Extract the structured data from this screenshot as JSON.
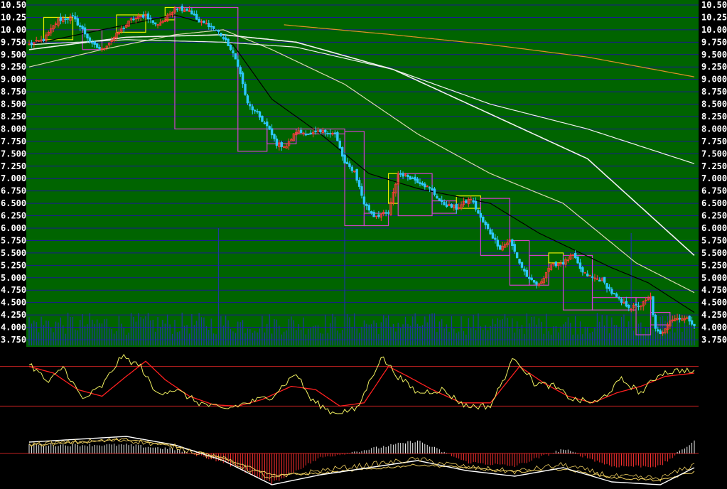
{
  "chart_data": {
    "type": "line",
    "subtype": "candlestick-with-indicators",
    "colors": {
      "price_background": "#006400",
      "indicator_background": "#000000",
      "gridline": "#1a1a90",
      "up_candle": "#ff3b3b",
      "down_candle": "#2ec8ff",
      "volume_bar": "#1d3a9e",
      "ma_short": "#000000",
      "ma_medium": "#d8d8b0",
      "ma_long": "#f0f0f0",
      "ma_longest": "#e0902a",
      "box_up": "#e8f000",
      "box_down": "#d040d0",
      "oscillator_k": "#f0f060",
      "oscillator_d": "#ff2020",
      "macd_dif": "#ffffff",
      "macd_dea": "#f0d060",
      "macd_hist_pos": "#f0f0f0",
      "macd_hist_neg": "#ff3030",
      "reference_line": "#c02020",
      "tick_label": "#ffffff"
    },
    "y_axis": {
      "ylim": [
        3.75,
        10.5
      ],
      "ticks": [
        "10.50",
        "10.25",
        "10.00",
        "9.750",
        "9.500",
        "9.250",
        "9.000",
        "8.750",
        "8.500",
        "8.250",
        "8.000",
        "7.750",
        "7.500",
        "7.250",
        "7.000",
        "6.750",
        "6.500",
        "6.250",
        "6.000",
        "5.750",
        "5.500",
        "5.250",
        "5.000",
        "4.750",
        "4.500",
        "4.250",
        "4.000",
        "3.750"
      ],
      "label_sides": [
        "left",
        "right"
      ],
      "grid": true
    },
    "price_series": {
      "bars": 220,
      "anchors": [
        [
          0,
          9.7
        ],
        [
          6,
          9.8
        ],
        [
          12,
          10.2
        ],
        [
          18,
          10.25
        ],
        [
          22,
          10.0
        ],
        [
          26,
          9.7
        ],
        [
          30,
          9.6
        ],
        [
          36,
          9.9
        ],
        [
          42,
          10.2
        ],
        [
          48,
          10.3
        ],
        [
          52,
          10.1
        ],
        [
          56,
          10.2
        ],
        [
          60,
          10.45
        ],
        [
          66,
          10.4
        ],
        [
          70,
          10.15
        ],
        [
          74,
          10.1
        ],
        [
          78,
          9.95
        ],
        [
          82,
          9.7
        ],
        [
          86,
          9.3
        ],
        [
          90,
          8.5
        ],
        [
          94,
          8.3
        ],
        [
          98,
          8.05
        ],
        [
          102,
          7.7
        ],
        [
          106,
          7.65
        ],
        [
          110,
          7.95
        ],
        [
          116,
          7.9
        ],
        [
          122,
          7.95
        ],
        [
          126,
          7.9
        ],
        [
          130,
          7.3
        ],
        [
          134,
          7.15
        ],
        [
          138,
          6.5
        ],
        [
          142,
          6.25
        ],
        [
          148,
          6.3
        ],
        [
          152,
          7.1
        ],
        [
          156,
          7.05
        ],
        [
          162,
          6.9
        ],
        [
          166,
          6.75
        ],
        [
          170,
          6.5
        ],
        [
          176,
          6.4
        ],
        [
          182,
          6.6
        ],
        [
          186,
          6.2
        ],
        [
          190,
          5.9
        ],
        [
          194,
          5.6
        ],
        [
          198,
          5.75
        ],
        [
          202,
          5.3
        ],
        [
          206,
          4.95
        ],
        [
          210,
          4.85
        ],
        [
          214,
          5.2
        ],
        [
          218,
          5.3
        ],
        [
          219,
          5.3
        ]
      ]
    },
    "price_series_tail": {
      "anchors": [
        [
          0,
          5.3
        ],
        [
          4,
          5.45
        ],
        [
          8,
          5.1
        ],
        [
          12,
          5.0
        ],
        [
          16,
          4.95
        ],
        [
          20,
          4.7
        ],
        [
          24,
          4.5
        ],
        [
          28,
          4.4
        ],
        [
          32,
          4.45
        ],
        [
          36,
          4.6
        ],
        [
          38,
          3.95
        ],
        [
          40,
          3.85
        ],
        [
          44,
          4.15
        ],
        [
          48,
          4.2
        ],
        [
          52,
          4.15
        ],
        [
          54,
          4.05
        ]
      ]
    },
    "moving_averages": [
      {
        "key": "ma_short",
        "anchors": [
          [
            0,
            9.7
          ],
          [
            40,
            10.1
          ],
          [
            60,
            10.3
          ],
          [
            74,
            10.1
          ],
          [
            84,
            9.7
          ],
          [
            100,
            8.6
          ],
          [
            120,
            7.9
          ],
          [
            140,
            7.1
          ],
          [
            160,
            6.8
          ],
          [
            190,
            6.5
          ],
          [
            210,
            5.9
          ],
          [
            240,
            5.2
          ],
          [
            255,
            4.9
          ],
          [
            274,
            4.3
          ]
        ]
      },
      {
        "key": "ma_medium",
        "anchors": [
          [
            0,
            9.25
          ],
          [
            30,
            9.6
          ],
          [
            60,
            9.9
          ],
          [
            80,
            10.0
          ],
          [
            100,
            9.6
          ],
          [
            130,
            8.9
          ],
          [
            160,
            7.9
          ],
          [
            190,
            7.1
          ],
          [
            220,
            6.5
          ],
          [
            250,
            5.3
          ],
          [
            274,
            4.7
          ]
        ]
      },
      {
        "key": "ma_long",
        "anchors": [
          [
            0,
            9.6
          ],
          [
            40,
            9.85
          ],
          [
            80,
            9.9
          ],
          [
            110,
            9.75
          ],
          [
            150,
            9.2
          ],
          [
            190,
            8.3
          ],
          [
            230,
            7.4
          ],
          [
            274,
            5.45
          ]
        ]
      },
      {
        "key": "ma_long_2",
        "anchors": [
          [
            0,
            9.7
          ],
          [
            40,
            9.8
          ],
          [
            80,
            9.75
          ],
          [
            110,
            9.65
          ],
          [
            150,
            9.2
          ],
          [
            190,
            8.5
          ],
          [
            230,
            8.0
          ],
          [
            274,
            7.3
          ]
        ]
      },
      {
        "key": "ma_longest",
        "anchors": [
          [
            105,
            10.1
          ],
          [
            150,
            9.9
          ],
          [
            190,
            9.7
          ],
          [
            230,
            9.45
          ],
          [
            274,
            9.05
          ]
        ]
      }
    ],
    "volume": {
      "description": "vertical bars along the bottom of the price panel",
      "spikes": [
        [
          78,
          6.0
        ],
        [
          130,
          6.0
        ],
        [
          248,
          5.9
        ]
      ]
    },
    "oscillator": {
      "reference_levels": [
        80,
        20
      ],
      "k_anchors": [
        [
          0,
          85
        ],
        [
          8,
          55
        ],
        [
          14,
          80
        ],
        [
          22,
          30
        ],
        [
          30,
          50
        ],
        [
          38,
          95
        ],
        [
          46,
          80
        ],
        [
          52,
          40
        ],
        [
          60,
          45
        ],
        [
          70,
          25
        ],
        [
          80,
          15
        ],
        [
          90,
          25
        ],
        [
          100,
          35
        ],
        [
          110,
          70
        ],
        [
          116,
          30
        ],
        [
          125,
          10
        ],
        [
          135,
          15
        ],
        [
          145,
          95
        ],
        [
          152,
          65
        ],
        [
          160,
          40
        ],
        [
          170,
          45
        ],
        [
          180,
          20
        ],
        [
          190,
          20
        ],
        [
          200,
          95
        ],
        [
          208,
          55
        ],
        [
          216,
          50
        ],
        [
          224,
          30
        ],
        [
          234,
          25
        ],
        [
          244,
          60
        ],
        [
          252,
          40
        ],
        [
          260,
          70
        ],
        [
          270,
          75
        ],
        [
          274,
          70
        ]
      ],
      "d_anchors": [
        [
          0,
          80
        ],
        [
          10,
          70
        ],
        [
          20,
          45
        ],
        [
          30,
          35
        ],
        [
          40,
          65
        ],
        [
          48,
          88
        ],
        [
          56,
          60
        ],
        [
          66,
          35
        ],
        [
          76,
          22
        ],
        [
          86,
          20
        ],
        [
          96,
          30
        ],
        [
          108,
          50
        ],
        [
          118,
          45
        ],
        [
          128,
          20
        ],
        [
          138,
          25
        ],
        [
          148,
          80
        ],
        [
          156,
          65
        ],
        [
          166,
          45
        ],
        [
          178,
          25
        ],
        [
          190,
          25
        ],
        [
          202,
          80
        ],
        [
          212,
          55
        ],
        [
          222,
          35
        ],
        [
          232,
          25
        ],
        [
          242,
          40
        ],
        [
          252,
          50
        ],
        [
          262,
          65
        ],
        [
          274,
          70
        ]
      ]
    },
    "macd": {
      "dif_anchors": [
        [
          0,
          8
        ],
        [
          20,
          10
        ],
        [
          40,
          12
        ],
        [
          60,
          6
        ],
        [
          80,
          -5
        ],
        [
          100,
          -22
        ],
        [
          120,
          -15
        ],
        [
          140,
          -10
        ],
        [
          160,
          -5
        ],
        [
          180,
          -12
        ],
        [
          200,
          -16
        ],
        [
          220,
          -10
        ],
        [
          240,
          -20
        ],
        [
          260,
          -22
        ],
        [
          274,
          -10
        ]
      ],
      "dea_anchors": [
        [
          0,
          6
        ],
        [
          20,
          8
        ],
        [
          40,
          10
        ],
        [
          60,
          5
        ],
        [
          80,
          -3
        ],
        [
          100,
          -15
        ],
        [
          120,
          -14
        ],
        [
          140,
          -11
        ],
        [
          160,
          -8
        ],
        [
          180,
          -10
        ],
        [
          200,
          -13
        ],
        [
          220,
          -11
        ],
        [
          240,
          -17
        ],
        [
          260,
          -19
        ],
        [
          274,
          -13
        ]
      ],
      "hist_range": [
        -22,
        12
      ]
    }
  }
}
